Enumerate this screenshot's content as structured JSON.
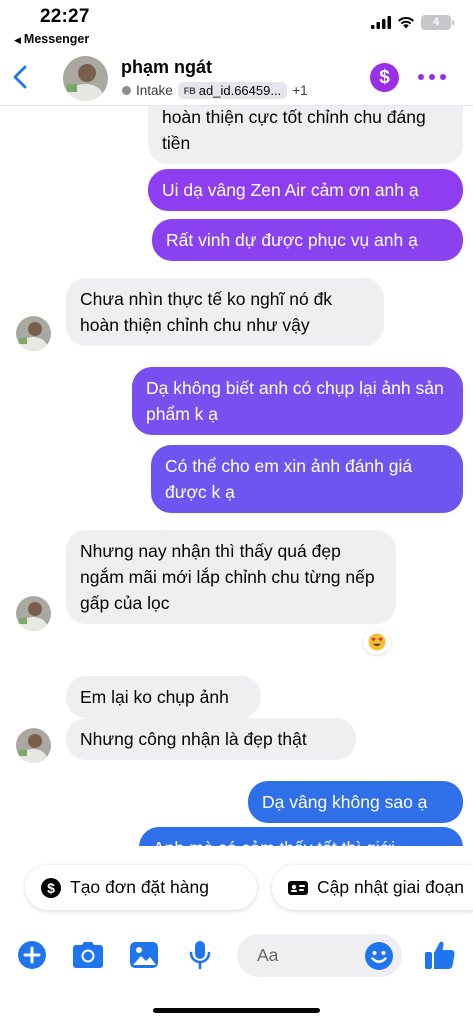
{
  "status_bar": {
    "time": "22:27",
    "back_app": "Messenger",
    "battery": "4"
  },
  "header": {
    "contact_name": "phạm ngát",
    "label": "Intake",
    "ad_prefix": "FB",
    "ad_id": "ad_id.66459...",
    "extra_count": "+1"
  },
  "messages": [
    {
      "side": "in",
      "text": "Nay nhận rồi xốp.cẩm quan thì thấy hoàn thiện cực tốt chỉnh chu đáng tiền"
    },
    {
      "side": "out",
      "text": "Ui dạ vâng Zen Air cảm ơn anh ạ"
    },
    {
      "side": "out",
      "text": "Rất vinh dự được phục vụ anh ạ"
    },
    {
      "side": "in",
      "text": "Chưa nhìn thực tế ko nghĩ nó đk hoàn thiện chỉnh chu như vậy"
    },
    {
      "side": "out",
      "text": "Dạ không biết anh có chụp lại ảnh sản phẩm k ạ"
    },
    {
      "side": "out",
      "text": "Có thể cho em xin ảnh đánh giá được k ạ"
    },
    {
      "side": "in",
      "text": "Nhưng nay nhận thì thấy quá đẹp ngắm mãi mới lắp chỉnh chu từng nếp gấp của lọc"
    },
    {
      "side": "in",
      "text": "Em lại ko chụp ảnh"
    },
    {
      "side": "in",
      "text": "Nhưng công nhận là đẹp thật"
    },
    {
      "side": "out",
      "text": "Dạ vâng không sao ạ"
    },
    {
      "side": "out",
      "text": "Anh mà có cảm thấy tốt thì giới"
    }
  ],
  "reaction": "heart-eyes-emoji",
  "quick_actions": [
    {
      "label": "Tạo đơn đặt hàng",
      "icon": "dollar-circle-icon"
    },
    {
      "label": "Cập nhật giai đoạn",
      "icon": "id-card-icon"
    }
  ],
  "composer": {
    "placeholder": "Aa"
  },
  "colors": {
    "accent_purple": "#9b2fe8",
    "accent_blue": "#2f6fe8",
    "incoming_bubble": "#efeff1",
    "composer_icon": "#1f75ee"
  }
}
